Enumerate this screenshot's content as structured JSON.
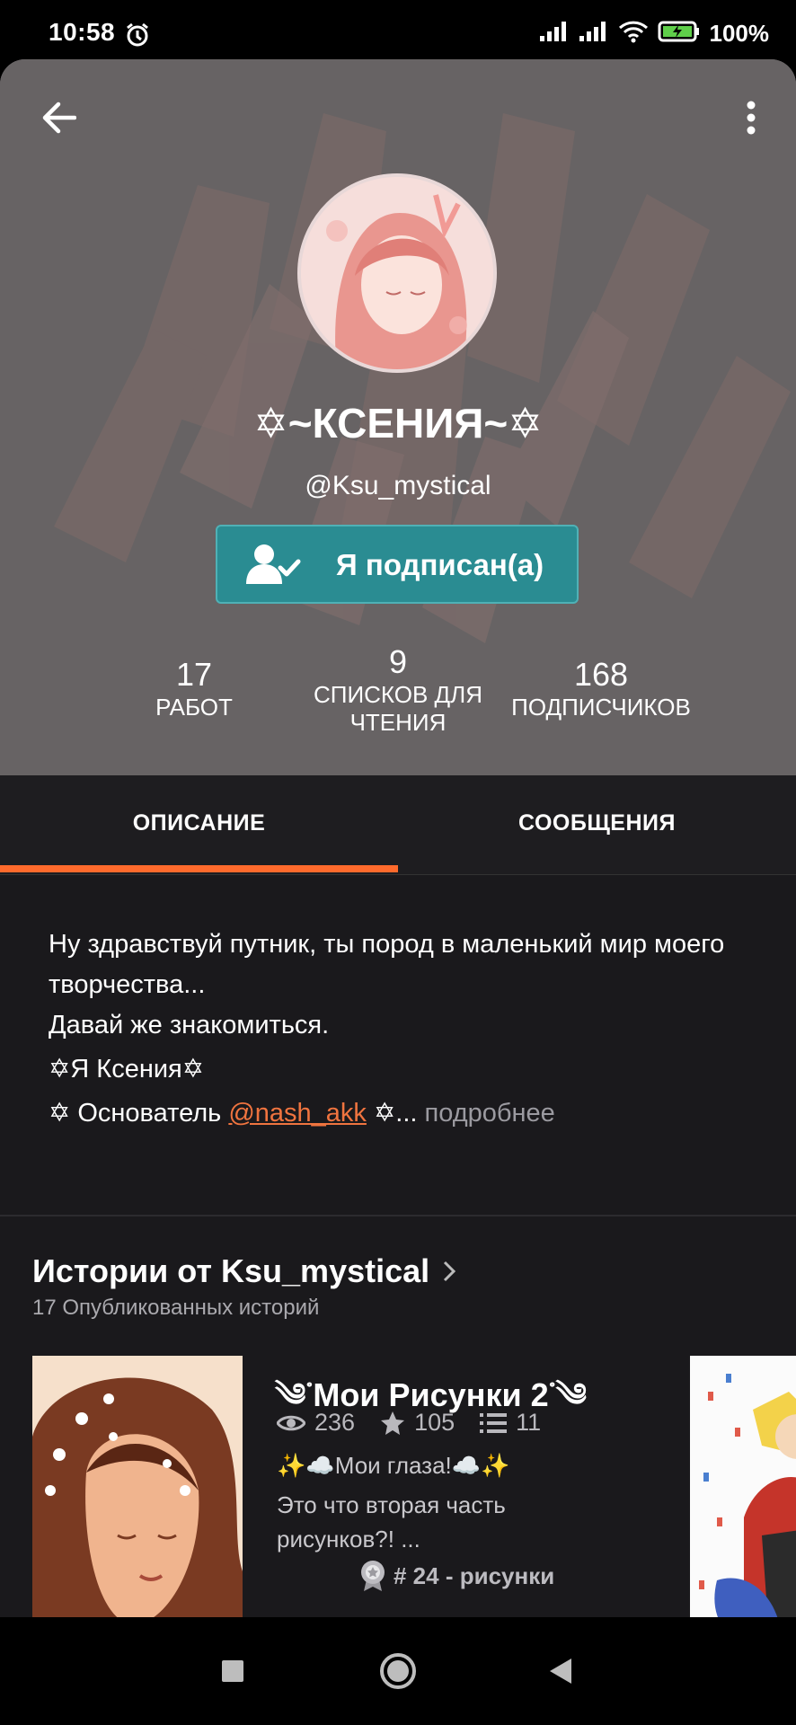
{
  "status_bar": {
    "time": "10:58",
    "battery": "100%"
  },
  "profile": {
    "display_name": "✡~КСЕНИЯ~✡",
    "username": "@Ksu_mystical",
    "follow_button": "Я подписан(а)",
    "stats": [
      {
        "value": "17",
        "label": "РАБОТ"
      },
      {
        "value": "9",
        "label": "СПИСКОВ ДЛЯ ЧТЕНИЯ"
      },
      {
        "value": "168",
        "label": "ПОДПИСЧИКОВ"
      }
    ]
  },
  "tabs": {
    "description": "ОПИСАНИЕ",
    "messages": "СООБЩЕНИЯ",
    "active": "description"
  },
  "description": {
    "line1": "Ну здравствуй путник, ты пород в маленький мир моего творчества...",
    "line2": "Давай же знакомиться.",
    "line3": "✡Я Ксения✡",
    "line4_prefix": "✡ Основатель ",
    "mention": "@nash_akk",
    "line4_suffix": " ✡...",
    "more": " подробнее"
  },
  "stories": {
    "title": "Истории от Ksu_mystical",
    "subtitle": "17 Опубликованных историй",
    "items": [
      {
        "title": "༄ᣞМои Рисунки 2ᣞ༄",
        "views": "236",
        "votes": "105",
        "parts": "11",
        "line1": "✨☁️Мои глаза!☁️✨",
        "desc": "Это что вторая часть рисунков?! ...",
        "rank": "# 24 - рисунки"
      }
    ]
  },
  "colors": {
    "accent": "#ff6a2c",
    "follow": "#2a8c92",
    "mention": "#f0743f",
    "background": "#1a191c"
  }
}
